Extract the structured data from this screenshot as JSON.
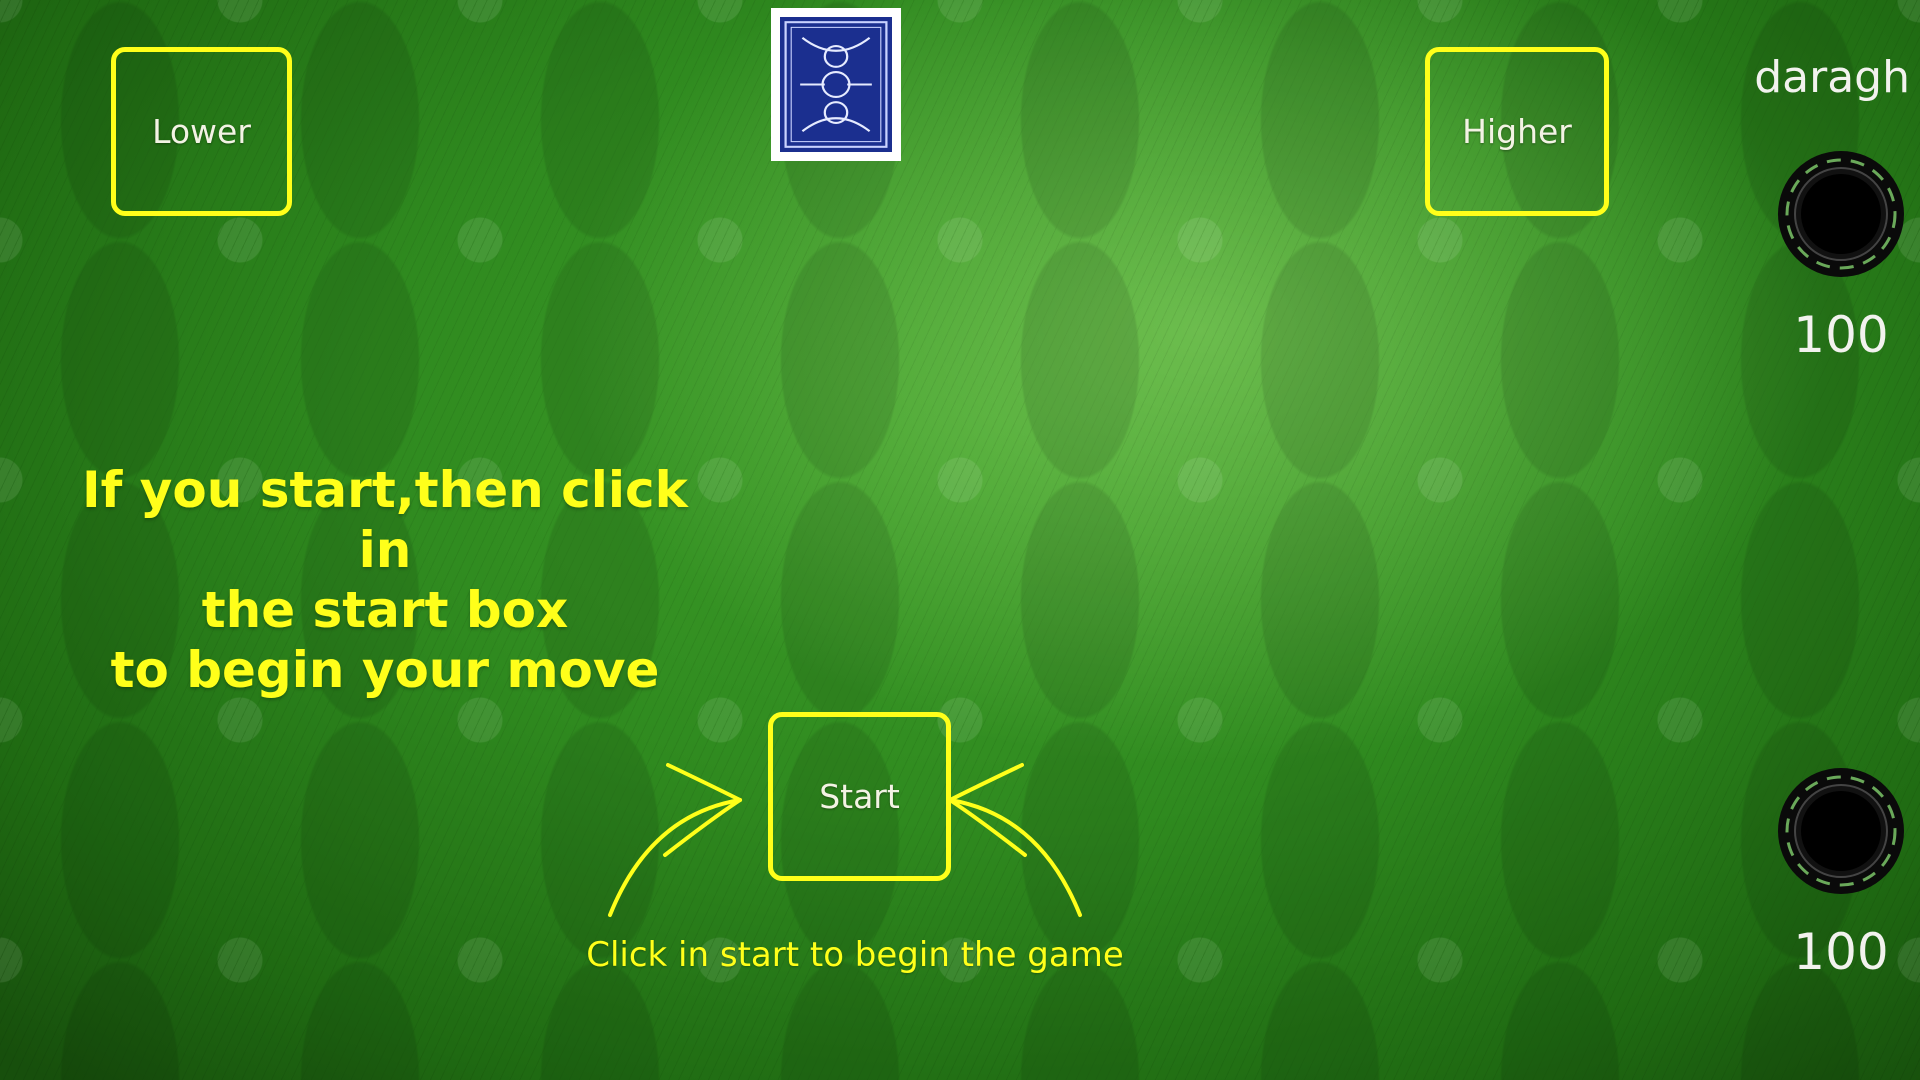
{
  "buttons": {
    "lower_label": "Lower",
    "higher_label": "Higher",
    "start_label": "Start"
  },
  "player": {
    "name": "daragh",
    "chips": [
      {
        "value": "100"
      },
      {
        "value": "100"
      }
    ]
  },
  "instructions": {
    "lines": [
      "If you start,then click in",
      "the start box",
      "to begin your move"
    ],
    "hint": "Click in start to begin the game"
  },
  "icons": {
    "card": "card-back-icon",
    "chip": "poker-chip-icon",
    "arrow": "curved-arrow-icon"
  },
  "colors": {
    "accent": "#ffff1a",
    "table_green": "#2f8a1f",
    "card_blue": "#1b2f8f"
  }
}
